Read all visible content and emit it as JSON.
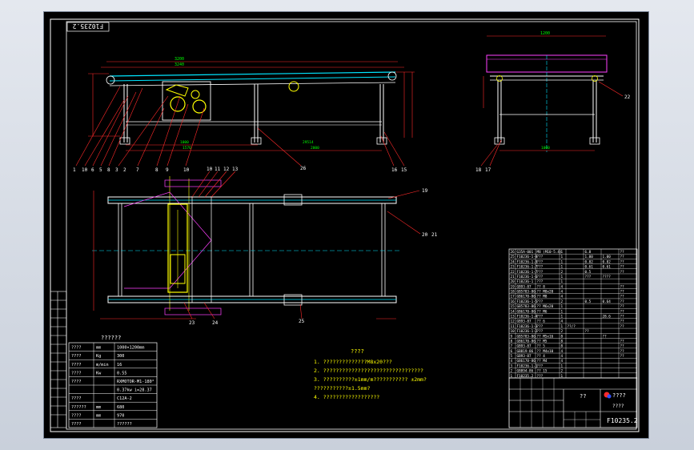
{
  "drawing": {
    "stamp_top": "F10235.2",
    "drawing_no": "F10235.2",
    "title_block_name": "????",
    "title_block_unit": "????",
    "title_block_mid": "??"
  },
  "balloons_top": [
    "1",
    "10",
    "6",
    "5",
    "8",
    "3",
    "2",
    "7",
    "8",
    "9",
    "10",
    "11",
    "12",
    "13",
    "14",
    "26",
    "16",
    "15",
    "18",
    "17",
    "22",
    "19",
    "20",
    "21",
    "23",
    "24",
    "25"
  ],
  "dims": {
    "top_overall": "3200",
    "top_span": "3240",
    "top_a": "1576",
    "top_b": "1000",
    "top_c": "29514",
    "top_d": "2000",
    "side_width": "1200",
    "side_base": "1000"
  },
  "tech_notes": {
    "heading": "????",
    "lines": [
      "1. ??????????????M8x20???",
      "2. ????????????????????????????????",
      "3. ??????????±1mm/m??????????? ±2mm?",
      "   ???????????±1.5mm?",
      "4. ??????????????????"
    ]
  },
  "params_table": {
    "heading": "??????",
    "rows": [
      {
        "name": "????",
        "unit": "mm",
        "value": "1000×1200mm"
      },
      {
        "name": "????",
        "unit": "Kg",
        "value": "300"
      },
      {
        "name": "????",
        "unit": "m/min",
        "value": "16"
      },
      {
        "name": "????",
        "unit": "Kw",
        "value": "0.55"
      },
      {
        "name": "????",
        "unit": "",
        "value": "RXMOTOR-M1-180°"
      },
      {
        "name": "",
        "unit": "",
        "value": "0.37kw i=28.37"
      },
      {
        "name": "????",
        "unit": "",
        "value": "C12A-2"
      },
      {
        "name": "??????",
        "unit": "mm",
        "value": "680"
      },
      {
        "name": "????",
        "unit": "mm",
        "value": "970"
      },
      {
        "name": "????",
        "unit": "",
        "value": "?????? "
      }
    ]
  },
  "bom": {
    "rows": [
      [
        "26",
        "G35A-001",
        "M8 (M10-5.4)",
        "1",
        "",
        "6.8",
        "",
        "??"
      ],
      [
        "25",
        "F10236-1-8",
        "???",
        "1",
        "",
        "1.00",
        "1.00",
        "??"
      ],
      [
        "24",
        "F10236-1-9",
        "???",
        "1",
        "",
        "0.82",
        "0.82",
        "??"
      ],
      [
        "23",
        "F10236-1-7",
        "???",
        "1",
        "",
        "0.61",
        "0.61",
        "??"
      ],
      [
        "22",
        "F10236-1-7",
        "???",
        "2",
        "",
        "0.5",
        "",
        "??"
      ],
      [
        "21",
        "F10236-1-6",
        "???",
        "1",
        "",
        "???",
        "????",
        ""
      ],
      [
        "20",
        "F10236-1",
        "???",
        "1",
        "",
        "",
        "",
        ""
      ],
      [
        "19",
        "GB93-87",
        "?? 8",
        "4",
        "",
        "",
        "",
        "??"
      ],
      [
        "18",
        "GB5783-86",
        "?? M8x20",
        "4",
        "",
        "",
        "",
        "??"
      ],
      [
        "17",
        "GB6170-86",
        "?? M8",
        "4",
        "",
        "",
        "",
        "??"
      ],
      [
        "16",
        "F10236-1-5",
        "???",
        "2",
        "",
        "0.5",
        "0.64",
        "??"
      ],
      [
        "15",
        "GB5783-86",
        "?? M6x20",
        "1",
        "",
        "",
        "",
        "??"
      ],
      [
        "14",
        "GB6170-86",
        "?? M6",
        "1",
        "",
        "",
        "",
        "??"
      ],
      [
        "13",
        "F10236-1-4",
        "???",
        "1",
        "",
        "",
        "28.6",
        "??"
      ],
      [
        "12",
        "GB93-87",
        "?? 6",
        "4",
        "",
        "",
        "",
        "??"
      ],
      [
        "11",
        "F10236-1-3",
        "???",
        "1",
        "??/?",
        "",
        "",
        "??"
      ],
      [
        "10",
        "F10236-1-2",
        "???",
        "2",
        "",
        "??",
        "",
        ""
      ],
      [
        "9",
        "GB5783-86",
        "?? M5x16",
        "8",
        "",
        "",
        "??",
        ""
      ],
      [
        "8",
        "GB6170-86",
        "?? M5",
        "8",
        "",
        "",
        "",
        "??"
      ],
      [
        "7",
        "GB93-87",
        "?? 5",
        "8",
        "",
        "",
        "",
        "??"
      ],
      [
        "6",
        "GB819-86",
        "?? M4x10",
        "4",
        "",
        "",
        "",
        "??"
      ],
      [
        "5",
        "GB93-87",
        "?? 4",
        "4",
        "",
        "",
        "",
        "??"
      ],
      [
        "4",
        "GB6170-86",
        "?? M4",
        "4",
        "",
        "",
        "",
        ""
      ],
      [
        "3",
        "F10236-1-1",
        "???",
        "1",
        "",
        "",
        "",
        ""
      ],
      [
        "2",
        "GB894-86",
        "?? 15",
        "2",
        "",
        "",
        "",
        ""
      ],
      [
        "1",
        "F10235.2",
        "???",
        "1",
        "",
        "",
        "",
        ""
      ]
    ]
  },
  "colors": {
    "frame": "#ffffff",
    "structure": "#00e5ff",
    "leader": "#ff2a2a",
    "motor": "#ffff00",
    "magenta": "#ff40ff",
    "text": "#ffffff",
    "green": "#00ff00"
  }
}
